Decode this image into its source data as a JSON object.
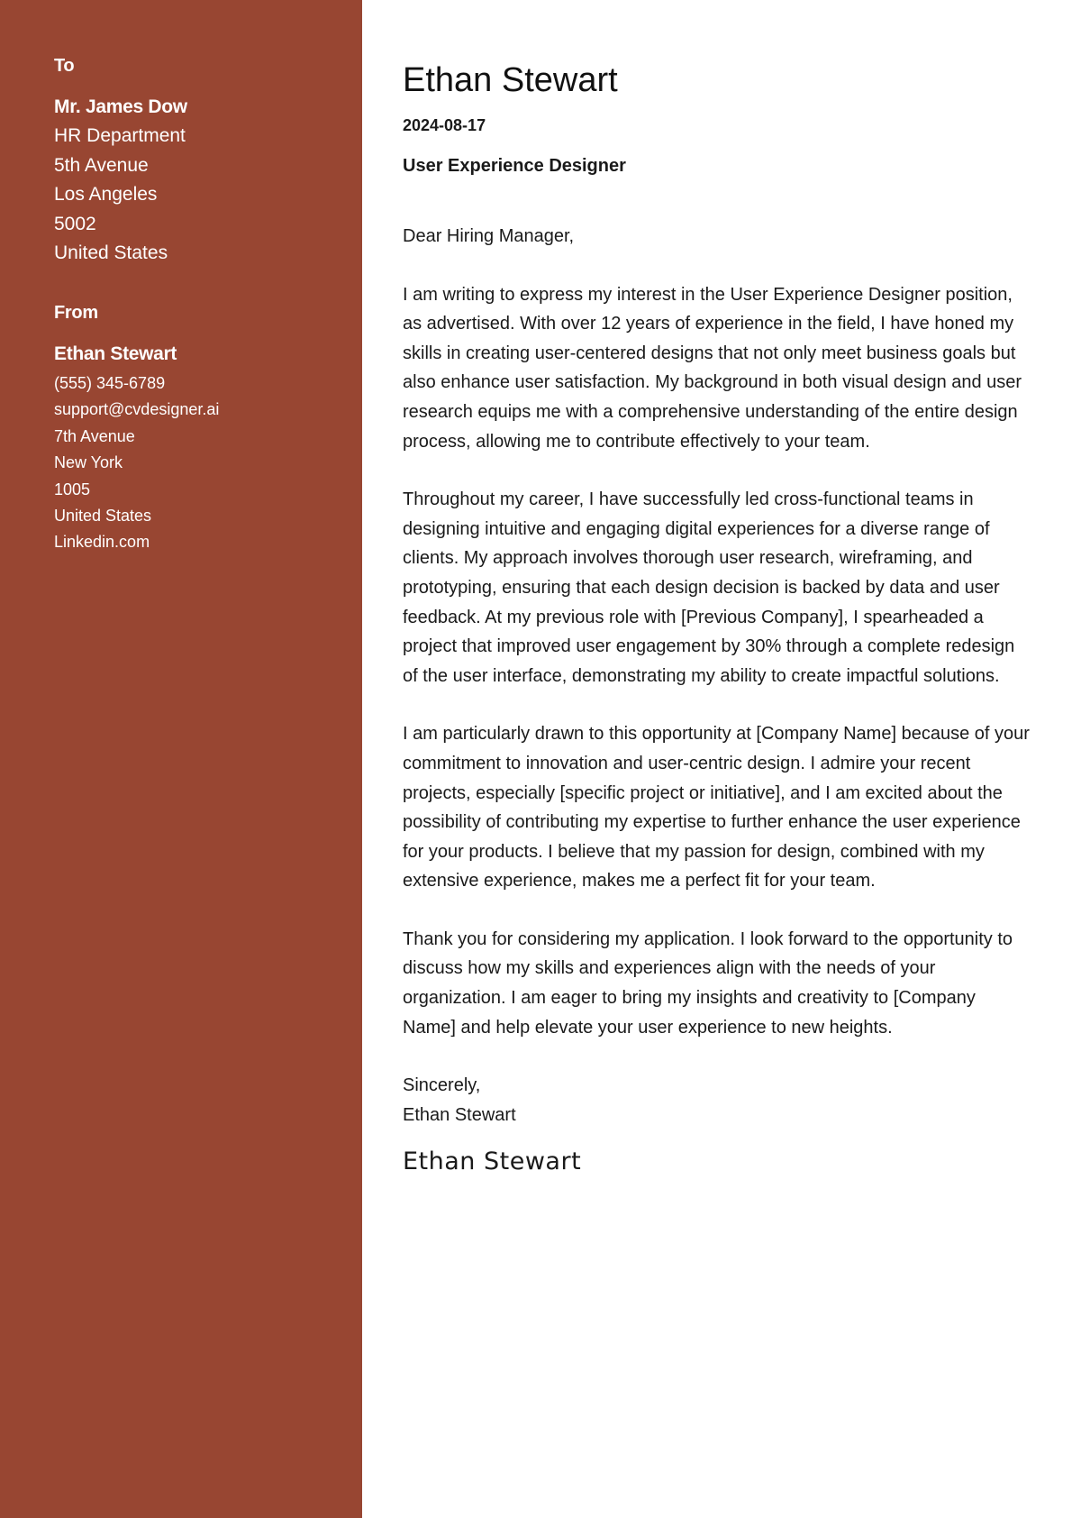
{
  "sidebar": {
    "to": {
      "heading": "To",
      "name": "Mr. James Dow",
      "lines": [
        "HR Department",
        "5th Avenue",
        "Los Angeles",
        "5002",
        "United States"
      ]
    },
    "from": {
      "heading": "From",
      "name": "Ethan Stewart",
      "lines": [
        "(555) 345-6789",
        "support@cvdesigner.ai",
        "7th Avenue",
        "New York",
        "1005",
        "United States",
        "Linkedin.com"
      ]
    },
    "background_color": "#984632"
  },
  "letter": {
    "name": "Ethan Stewart",
    "date": "2024-08-17",
    "job_title": "User Experience Designer",
    "greeting": "Dear Hiring Manager,",
    "paragraphs": [
      "I am writing to express my interest in the User Experience Designer position, as advertised. With over 12 years of experience in the field, I have honed my skills in creating user-centered designs that not only meet business goals but also enhance user satisfaction. My background in both visual design and user research equips me with a comprehensive understanding of the entire design process, allowing me to contribute effectively to your team.",
      "Throughout my career, I have successfully led cross-functional teams in designing intuitive and engaging digital experiences for a diverse range of clients. My approach involves thorough user research, wireframing, and prototyping, ensuring that each design decision is backed by data and user feedback. At my previous role with [Previous Company], I spearheaded a project that improved user engagement by 30% through a complete redesign of the user interface, demonstrating my ability to create impactful solutions.",
      "I am particularly drawn to this opportunity at [Company Name] because of your commitment to innovation and user-centric design. I admire your recent projects, especially [specific project or initiative], and I am excited about the possibility of contributing my expertise to further enhance the user experience for your products. I believe that my passion for design, combined with my extensive experience, makes me a perfect fit for your team.",
      "Thank you for considering my application. I look forward to the opportunity to discuss how my skills and experiences align with the needs of your organization. I am eager to bring my insights and creativity to [Company Name] and help elevate your user experience to new heights."
    ],
    "closing": "Sincerely,",
    "closing_name": "Ethan Stewart",
    "signature": "Ethan Stewart"
  }
}
